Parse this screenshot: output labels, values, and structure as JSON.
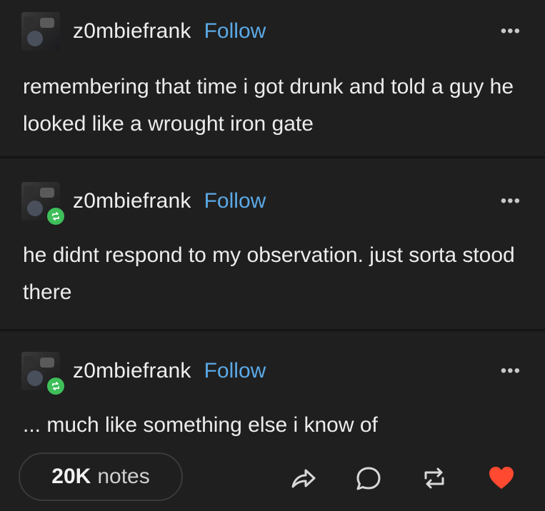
{
  "posts": [
    {
      "username": "z0mbiefrank",
      "follow_label": "Follow",
      "more_label": "•••",
      "text": "remembering that time i got drunk and told a guy he looked like a wrought iron gate",
      "reblogged": false
    },
    {
      "username": "z0mbiefrank",
      "follow_label": "Follow",
      "more_label": "•••",
      "text": "he didnt respond to my observation. just sorta stood there",
      "reblogged": true
    },
    {
      "username": "z0mbiefrank",
      "follow_label": "Follow",
      "more_label": "•••",
      "text": "... much like something else i know of",
      "reblogged": true
    }
  ],
  "footer": {
    "notes_count": "20K",
    "notes_label": "notes",
    "icons": [
      "share-icon",
      "reply-icon",
      "reblog-icon",
      "heart-icon"
    ],
    "heart_color": "#ff4930"
  },
  "colors": {
    "background": "#1f1f1f",
    "follow": "#5aa9e6",
    "reblog_badge": "#3fbf5a"
  }
}
